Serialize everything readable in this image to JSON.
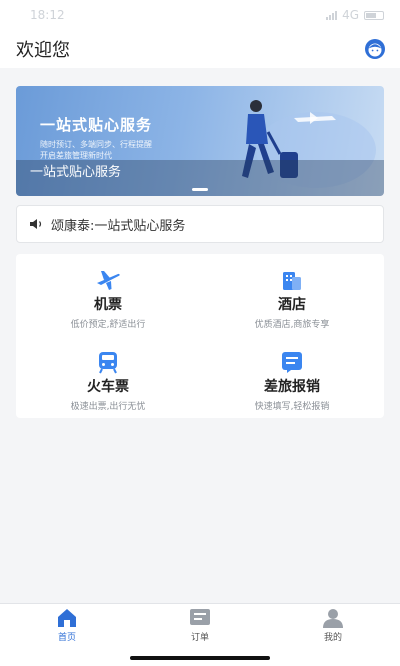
{
  "status": {
    "time": "18:12",
    "network": "4G"
  },
  "header": {
    "title": "欢迎您"
  },
  "banner": {
    "title": "一站式贴心服务",
    "subtitle_line1": "随时预订、多端同步、行程提醒",
    "subtitle_line2": "开启差旅管理新时代",
    "caption": "一站式贴心服务"
  },
  "notice": {
    "text": "颂康泰:一站式贴心服务"
  },
  "services": [
    {
      "name": "机票",
      "desc": "低价预定,舒适出行",
      "icon": "plane-icon"
    },
    {
      "name": "酒店",
      "desc": "优质酒店,商旅专享",
      "icon": "hotel-icon"
    },
    {
      "name": "火车票",
      "desc": "极速出票,出行无忧",
      "icon": "train-icon"
    },
    {
      "name": "差旅报销",
      "desc": "快速填写,轻松报销",
      "icon": "reimburse-icon"
    }
  ],
  "tabs": [
    {
      "label": "首页",
      "icon": "home-icon",
      "active": true
    },
    {
      "label": "订单",
      "icon": "order-icon",
      "active": false
    },
    {
      "label": "我的",
      "icon": "profile-icon",
      "active": false
    }
  ],
  "colors": {
    "accent": "#2f6fd6",
    "icon_blue": "#3b86f0",
    "inactive_icon": "#9aa0a8"
  }
}
